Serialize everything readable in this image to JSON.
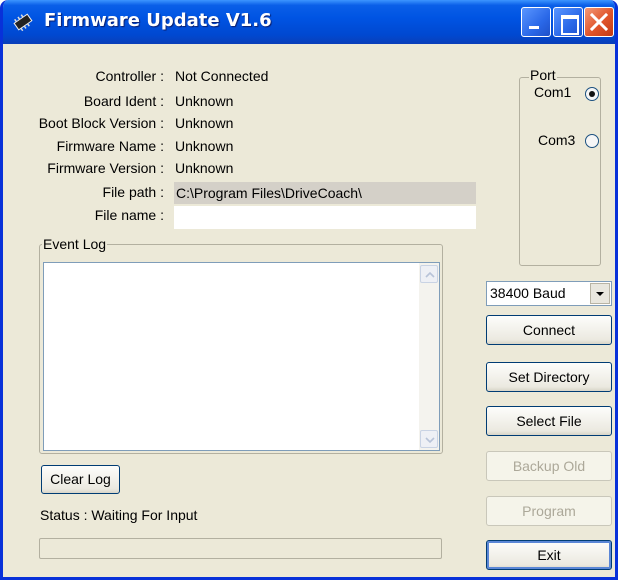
{
  "window": {
    "title": "Firmware Update V1.6"
  },
  "info": [
    {
      "label": "Controller :",
      "value": "Not Connected"
    },
    {
      "label": "Board Ident :",
      "value": "Unknown"
    },
    {
      "label": "Boot Block Version :",
      "value": "Unknown"
    },
    {
      "label": "Firmware Name :",
      "value": "Unknown"
    },
    {
      "label": "Firmware Version :",
      "value": "Unknown"
    },
    {
      "label": "File path :",
      "value": "C:\\Program Files\\DriveCoach\\"
    },
    {
      "label": "File name :",
      "value": ""
    }
  ],
  "event_log": {
    "legend": "Event Log",
    "content": ""
  },
  "port": {
    "legend": "Port",
    "options": [
      {
        "label": "Com1",
        "checked": true
      },
      {
        "label": "Com3",
        "checked": false
      }
    ]
  },
  "baud": {
    "selected": "38400 Baud"
  },
  "buttons": {
    "connect": "Connect",
    "set_directory": "Set Directory",
    "select_file": "Select File",
    "backup_old": "Backup Old",
    "program": "Program",
    "exit": "Exit",
    "clear_log": "Clear Log"
  },
  "status": {
    "text": "Status : Waiting For Input",
    "progress": 0
  },
  "icons": {
    "app": "chip-icon",
    "minimize": "minimize-icon",
    "maximize": "maximize-icon",
    "close": "close-icon",
    "scroll_up": "arrow-up-icon",
    "scroll_down": "arrow-down-icon",
    "dropdown": "chevron-down-icon"
  }
}
